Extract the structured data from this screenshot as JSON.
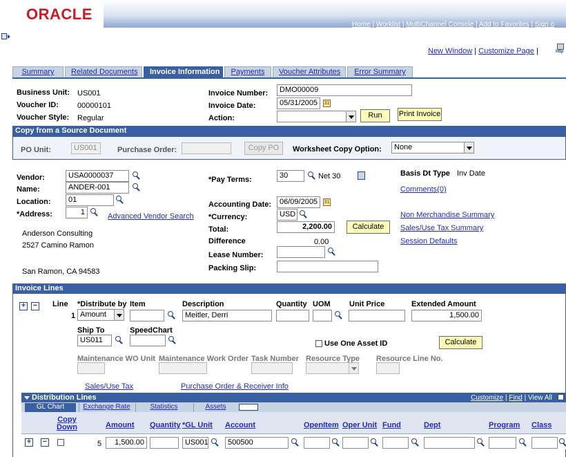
{
  "header": {
    "logo": "ORACLE",
    "links": [
      "Home",
      "Worklist",
      "MultiChannel Console",
      "Add to Favorites",
      "Sign o"
    ]
  },
  "page_links": {
    "new_window": "New Window",
    "customize_page": "Customize Page",
    "http_icon": "http"
  },
  "tabs": [
    "Summary",
    "Related Documents",
    "Invoice Information",
    "Payments",
    "Voucher Attributes",
    "Error Summary"
  ],
  "top": {
    "business_unit_label": "Business Unit:",
    "business_unit": "US001",
    "voucher_id_label": "Voucher ID:",
    "voucher_id": "00000101",
    "voucher_style_label": "Voucher Style:",
    "voucher_style": "Regular",
    "invoice_number_label": "Invoice Number:",
    "invoice_number": "DMO00009",
    "invoice_date_label": "Invoice Date:",
    "invoice_date": "05/31/2005",
    "action_label": "Action:",
    "action_value": "",
    "run_button": "Run",
    "print_invoice_button": "Print Invoice"
  },
  "copy_source": {
    "header": "Copy from a Source Document",
    "po_unit_label": "PO Unit:",
    "po_unit": "US001",
    "purchase_order_label": "Purchase Order:",
    "purchase_order": "",
    "copy_po_button": "Copy PO",
    "worksheet_label": "Worksheet Copy Option:",
    "worksheet_value": "None"
  },
  "vendor": {
    "vendor_label": "Vendor:",
    "vendor": "USA0000037",
    "name_label": "Name:",
    "name": "ANDER-001",
    "location_label": "Location:",
    "location": "01",
    "address_label": "*Address:",
    "address": "1",
    "advanced_search": "Advanced Vendor Search",
    "address_lines": [
      "Anderson Consulting",
      "2527 Camino Ramon",
      "San Ramon, CA  94583"
    ]
  },
  "terms": {
    "pay_terms_label": "*Pay Terms:",
    "pay_terms": "30",
    "pay_terms_desc": "Net 30",
    "accounting_date_label": "Accounting Date:",
    "accounting_date": "06/09/2005",
    "currency_label": "*Currency:",
    "currency": "USD",
    "total_label": "Total:",
    "total": "2,200.00",
    "calculate_button": "Calculate",
    "difference_label": "Difference",
    "difference": "0.00",
    "lease_label": "Lease Number:",
    "lease": "",
    "packing_label": "Packing Slip:",
    "packing": ""
  },
  "side": {
    "basis_label": "Basis Dt Type",
    "basis_value": "Inv Date",
    "comments": "Comments(0)",
    "non_merch": "Non Merchandise Summary",
    "sales_tax": "Sales/Use Tax Summary",
    "session": "Session Defaults"
  },
  "invoice_lines": {
    "header": "Invoice Lines",
    "line_label": "Line",
    "line_no": "1",
    "distribute_label": "*Distribute by",
    "distribute_value": "Amount",
    "item_label": "Item",
    "item": "",
    "desc_label": "Description",
    "desc": "Meitler, Derri",
    "qty_label": "Quantity",
    "uom_label": "UOM",
    "unit_price_label": "Unit Price",
    "ext_amount_label": "Extended Amount",
    "ext_amount": "1,500.00",
    "ship_to_label": "Ship To",
    "ship_to": "US011",
    "speedchart_label": "SpeedChart",
    "speedchart": "",
    "use_asset": "Use One Asset ID",
    "calculate_button": "Calculate",
    "mwo_unit": "Maintenance WO Unit",
    "mwo": "Maintenance Work Order",
    "task": "Task Number",
    "resource_type": "Resource Type",
    "resource_line": "Resource Line No.",
    "sales_tax_link": "Sales/Use Tax",
    "po_receiver_link": "Purchase Order & Receiver Info"
  },
  "dist_lines": {
    "header": "Distribution Lines",
    "right_links": [
      "Customize",
      "Find",
      "View All"
    ],
    "tabs": [
      "GL Chart",
      "Exchange Rate",
      "Statistics",
      "Assets"
    ],
    "columns": [
      "Copy Down",
      "Amount",
      "Quantity",
      "*GL Unit",
      "Account",
      "OpenItem",
      "Oper Unit",
      "Fund",
      "Dept",
      "Program",
      "Class"
    ],
    "row": {
      "line": "5",
      "amount": "1,500.00",
      "quantity": "",
      "gl_unit": "US001",
      "account": "500500"
    }
  }
}
